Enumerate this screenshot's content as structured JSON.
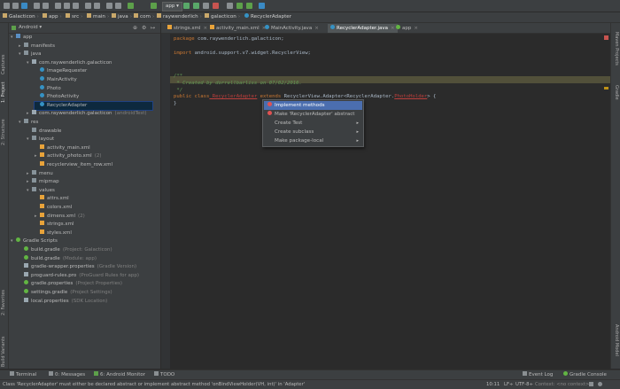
{
  "toolbar": {
    "run_config": "app",
    "icons": [
      "open-icon",
      "save-icon",
      "sync-icon",
      "undo-icon",
      "redo-icon",
      "cut-icon",
      "copy-icon",
      "paste-icon",
      "find-icon",
      "replace-icon",
      "back-icon",
      "forward-icon",
      "make-icon",
      "run-icon",
      "debug-icon",
      "attach-icon",
      "stop-icon",
      "avd-icon",
      "sdk-icon",
      "android-monitor-icon",
      "help-icon"
    ]
  },
  "breadcrumb": [
    "Galacticon",
    "app",
    "src",
    "main",
    "java",
    "com",
    "raywenderlich",
    "galacticon",
    "RecyclerAdapter"
  ],
  "left_tabs": [
    "1: Project",
    "2: Structure",
    "Captures",
    "2: Favorites",
    "Build Variants"
  ],
  "right_tabs": [
    "Maven Projects",
    "Gradle",
    "Android Model"
  ],
  "project_panel": {
    "view_selector": "Android",
    "tree": [
      {
        "label": "app",
        "hint": "",
        "icon": "module",
        "arrow": "▾",
        "depth": 0
      },
      {
        "label": "manifests",
        "hint": "",
        "icon": "folder",
        "arrow": "▸",
        "depth": 1
      },
      {
        "label": "java",
        "hint": "",
        "icon": "folder",
        "arrow": "▾",
        "depth": 1
      },
      {
        "label": "com.raywenderlich.galacticon",
        "hint": "",
        "icon": "package",
        "arrow": "▾",
        "depth": 2
      },
      {
        "label": "ImageRequester",
        "hint": "",
        "icon": "class",
        "arrow": "",
        "depth": 3
      },
      {
        "label": "MainActivity",
        "hint": "",
        "icon": "class",
        "arrow": "",
        "depth": 3
      },
      {
        "label": "Photo",
        "hint": "",
        "icon": "class",
        "arrow": "",
        "depth": 3
      },
      {
        "label": "PhotoActivity",
        "hint": "",
        "icon": "class",
        "arrow": "",
        "depth": 3
      },
      {
        "label": "RecyclerAdapter",
        "hint": "",
        "icon": "class",
        "arrow": "",
        "depth": 3,
        "selected": true
      },
      {
        "label": "com.raywenderlich.galacticon",
        "hint": "(androidTest)",
        "icon": "package",
        "arrow": "▸",
        "depth": 2
      },
      {
        "label": "res",
        "hint": "",
        "icon": "folder",
        "arrow": "▾",
        "depth": 1
      },
      {
        "label": "drawable",
        "hint": "",
        "icon": "folder",
        "arrow": "",
        "depth": 2
      },
      {
        "label": "layout",
        "hint": "",
        "icon": "folder",
        "arrow": "▾",
        "depth": 2
      },
      {
        "label": "activity_main.xml",
        "hint": "",
        "icon": "xml",
        "arrow": "",
        "depth": 3
      },
      {
        "label": "activity_photo.xml",
        "hint": "(2)",
        "icon": "xml",
        "arrow": "▸",
        "depth": 3
      },
      {
        "label": "recyclerview_item_row.xml",
        "hint": "",
        "icon": "xml",
        "arrow": "",
        "depth": 3
      },
      {
        "label": "menu",
        "hint": "",
        "icon": "folder",
        "arrow": "▸",
        "depth": 2
      },
      {
        "label": "mipmap",
        "hint": "",
        "icon": "folder",
        "arrow": "▸",
        "depth": 2
      },
      {
        "label": "values",
        "hint": "",
        "icon": "folder",
        "arrow": "▾",
        "depth": 2
      },
      {
        "label": "attrs.xml",
        "hint": "",
        "icon": "xml",
        "arrow": "",
        "depth": 3
      },
      {
        "label": "colors.xml",
        "hint": "",
        "icon": "xml",
        "arrow": "",
        "depth": 3
      },
      {
        "label": "dimens.xml",
        "hint": "(2)",
        "icon": "xml",
        "arrow": "▸",
        "depth": 3
      },
      {
        "label": "strings.xml",
        "hint": "",
        "icon": "xml",
        "arrow": "",
        "depth": 3
      },
      {
        "label": "styles.xml",
        "hint": "",
        "icon": "xml",
        "arrow": "",
        "depth": 3
      },
      {
        "label": "Gradle Scripts",
        "hint": "",
        "icon": "gradle",
        "arrow": "▾",
        "depth": 0
      },
      {
        "label": "build.gradle",
        "hint": "(Project: Galacticon)",
        "icon": "gradle",
        "arrow": "",
        "depth": 1
      },
      {
        "label": "build.gradle",
        "hint": "(Module: app)",
        "icon": "gradle",
        "arrow": "",
        "depth": 1
      },
      {
        "label": "gradle-wrapper.properties",
        "hint": "(Gradle Version)",
        "icon": "prop",
        "arrow": "",
        "depth": 1
      },
      {
        "label": "proguard-rules.pro",
        "hint": "(ProGuard Rules for app)",
        "icon": "prop",
        "arrow": "",
        "depth": 1
      },
      {
        "label": "gradle.properties",
        "hint": "(Project Properties)",
        "icon": "gradle",
        "arrow": "",
        "depth": 1
      },
      {
        "label": "settings.gradle",
        "hint": "(Project Settings)",
        "icon": "gradle",
        "arrow": "",
        "depth": 1
      },
      {
        "label": "local.properties",
        "hint": "(SDK Location)",
        "icon": "prop",
        "arrow": "",
        "depth": 1
      }
    ]
  },
  "editor_tabs": [
    {
      "label": "strings.xml",
      "active": false
    },
    {
      "label": "activity_main.xml",
      "active": false
    },
    {
      "label": "MainActivity.java",
      "active": false
    },
    {
      "label": "RecyclerAdapter.java",
      "active": true
    },
    {
      "label": "app",
      "active": false
    }
  ],
  "code": {
    "package_kw": "package",
    "package_name": " com.raywenderlich.galacticon;",
    "import_kw": "import",
    "import_name": " android.support.v7.widget.RecyclerView;",
    "comment_open": "/**",
    "comment_body": " * Created by dorrellbarliss on 07/02/2016.",
    "comment_close": " */",
    "class_kw": "public class",
    "class_name": " RecyclerAdapter",
    "extends_kw": " extends",
    "extends_type": " RecyclerView.Adapter<RecyclerAdapter.",
    "err_name": "PhotoHolder",
    "decl_end": "> {",
    "close_brace": "}"
  },
  "intention_popup": {
    "items": [
      {
        "label": "Implement methods",
        "icon": "bulb",
        "submenu": false,
        "highlighted": true
      },
      {
        "label": "Make 'RecyclerAdapter' abstract",
        "icon": "bulb",
        "submenu": false,
        "highlighted": false
      },
      {
        "label": "Create Test",
        "icon": "sub",
        "submenu": true,
        "highlighted": false
      },
      {
        "label": "Create subclass",
        "icon": "sub",
        "submenu": true,
        "highlighted": false
      },
      {
        "label": "Make package-local",
        "icon": "sub",
        "submenu": true,
        "highlighted": false
      }
    ]
  },
  "bottom_tools": {
    "terminal": "Terminal",
    "messages": "0: Messages",
    "android_monitor": "6: Android Monitor",
    "todo": "TODO",
    "event_log": "Event Log",
    "gradle_console": "Gradle Console"
  },
  "status": {
    "message": "Class 'RecyclerAdapter' must either be declared abstract or implement abstract method 'onBindViewHolder(VH, int)' in 'Adapter'",
    "position": "10:11",
    "line_sep": "LF÷",
    "encoding": "UTF-8÷",
    "context": "Context: <no context>"
  }
}
